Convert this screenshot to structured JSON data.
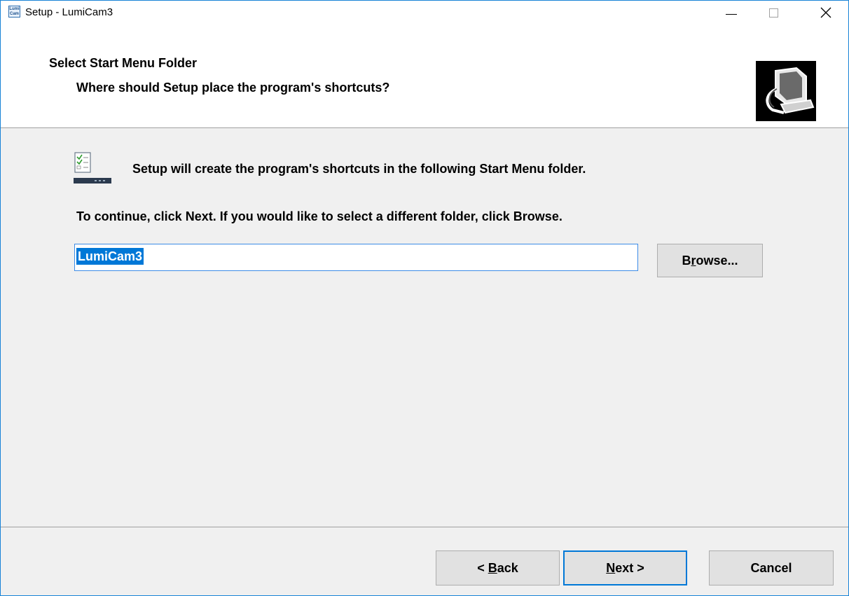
{
  "window": {
    "title": "Setup - LumiCam3",
    "app_icon_text": "Lumi Cam"
  },
  "header": {
    "title": "Select Start Menu Folder",
    "subtitle": "Where should Setup place the program's shortcuts?"
  },
  "content": {
    "info": "Setup will create the program's shortcuts in the following Start Menu folder.",
    "instruction": "To continue, click Next. If you would like to select a different folder, click Browse.",
    "folder_value": "LumiCam3",
    "browse": {
      "pre": "B",
      "key": "r",
      "post": "owse..."
    }
  },
  "footer": {
    "back": {
      "pre": "< ",
      "key": "B",
      "post": "ack"
    },
    "next": {
      "pre": "",
      "key": "N",
      "post": "ext >"
    },
    "cancel": "Cancel"
  },
  "colors": {
    "accent": "#0078d7",
    "window_border": "#1883d7",
    "panel_bg": "#f0f0f0",
    "button_bg": "#e1e1e1"
  },
  "icons": [
    "app-icon",
    "minimize-icon",
    "maximize-icon",
    "close-icon",
    "wizard-computer-icon",
    "start-menu-folder-icon"
  ]
}
